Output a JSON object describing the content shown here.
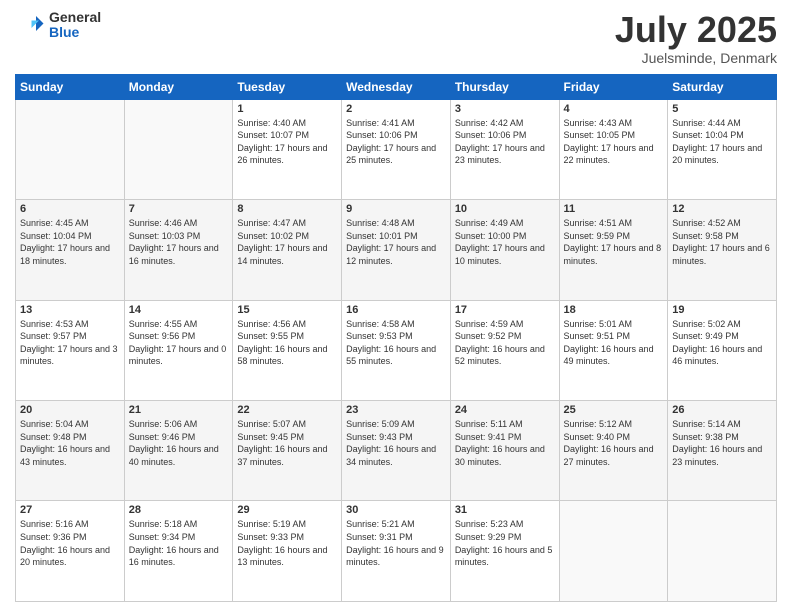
{
  "header": {
    "logo_general": "General",
    "logo_blue": "Blue",
    "title": "July 2025",
    "location": "Juelsminde, Denmark"
  },
  "days_of_week": [
    "Sunday",
    "Monday",
    "Tuesday",
    "Wednesday",
    "Thursday",
    "Friday",
    "Saturday"
  ],
  "weeks": [
    [
      {
        "day": "",
        "content": ""
      },
      {
        "day": "",
        "content": ""
      },
      {
        "day": "1",
        "content": "Sunrise: 4:40 AM\nSunset: 10:07 PM\nDaylight: 17 hours and 26 minutes."
      },
      {
        "day": "2",
        "content": "Sunrise: 4:41 AM\nSunset: 10:06 PM\nDaylight: 17 hours and 25 minutes."
      },
      {
        "day": "3",
        "content": "Sunrise: 4:42 AM\nSunset: 10:06 PM\nDaylight: 17 hours and 23 minutes."
      },
      {
        "day": "4",
        "content": "Sunrise: 4:43 AM\nSunset: 10:05 PM\nDaylight: 17 hours and 22 minutes."
      },
      {
        "day": "5",
        "content": "Sunrise: 4:44 AM\nSunset: 10:04 PM\nDaylight: 17 hours and 20 minutes."
      }
    ],
    [
      {
        "day": "6",
        "content": "Sunrise: 4:45 AM\nSunset: 10:04 PM\nDaylight: 17 hours and 18 minutes."
      },
      {
        "day": "7",
        "content": "Sunrise: 4:46 AM\nSunset: 10:03 PM\nDaylight: 17 hours and 16 minutes."
      },
      {
        "day": "8",
        "content": "Sunrise: 4:47 AM\nSunset: 10:02 PM\nDaylight: 17 hours and 14 minutes."
      },
      {
        "day": "9",
        "content": "Sunrise: 4:48 AM\nSunset: 10:01 PM\nDaylight: 17 hours and 12 minutes."
      },
      {
        "day": "10",
        "content": "Sunrise: 4:49 AM\nSunset: 10:00 PM\nDaylight: 17 hours and 10 minutes."
      },
      {
        "day": "11",
        "content": "Sunrise: 4:51 AM\nSunset: 9:59 PM\nDaylight: 17 hours and 8 minutes."
      },
      {
        "day": "12",
        "content": "Sunrise: 4:52 AM\nSunset: 9:58 PM\nDaylight: 17 hours and 6 minutes."
      }
    ],
    [
      {
        "day": "13",
        "content": "Sunrise: 4:53 AM\nSunset: 9:57 PM\nDaylight: 17 hours and 3 minutes."
      },
      {
        "day": "14",
        "content": "Sunrise: 4:55 AM\nSunset: 9:56 PM\nDaylight: 17 hours and 0 minutes."
      },
      {
        "day": "15",
        "content": "Sunrise: 4:56 AM\nSunset: 9:55 PM\nDaylight: 16 hours and 58 minutes."
      },
      {
        "day": "16",
        "content": "Sunrise: 4:58 AM\nSunset: 9:53 PM\nDaylight: 16 hours and 55 minutes."
      },
      {
        "day": "17",
        "content": "Sunrise: 4:59 AM\nSunset: 9:52 PM\nDaylight: 16 hours and 52 minutes."
      },
      {
        "day": "18",
        "content": "Sunrise: 5:01 AM\nSunset: 9:51 PM\nDaylight: 16 hours and 49 minutes."
      },
      {
        "day": "19",
        "content": "Sunrise: 5:02 AM\nSunset: 9:49 PM\nDaylight: 16 hours and 46 minutes."
      }
    ],
    [
      {
        "day": "20",
        "content": "Sunrise: 5:04 AM\nSunset: 9:48 PM\nDaylight: 16 hours and 43 minutes."
      },
      {
        "day": "21",
        "content": "Sunrise: 5:06 AM\nSunset: 9:46 PM\nDaylight: 16 hours and 40 minutes."
      },
      {
        "day": "22",
        "content": "Sunrise: 5:07 AM\nSunset: 9:45 PM\nDaylight: 16 hours and 37 minutes."
      },
      {
        "day": "23",
        "content": "Sunrise: 5:09 AM\nSunset: 9:43 PM\nDaylight: 16 hours and 34 minutes."
      },
      {
        "day": "24",
        "content": "Sunrise: 5:11 AM\nSunset: 9:41 PM\nDaylight: 16 hours and 30 minutes."
      },
      {
        "day": "25",
        "content": "Sunrise: 5:12 AM\nSunset: 9:40 PM\nDaylight: 16 hours and 27 minutes."
      },
      {
        "day": "26",
        "content": "Sunrise: 5:14 AM\nSunset: 9:38 PM\nDaylight: 16 hours and 23 minutes."
      }
    ],
    [
      {
        "day": "27",
        "content": "Sunrise: 5:16 AM\nSunset: 9:36 PM\nDaylight: 16 hours and 20 minutes."
      },
      {
        "day": "28",
        "content": "Sunrise: 5:18 AM\nSunset: 9:34 PM\nDaylight: 16 hours and 16 minutes."
      },
      {
        "day": "29",
        "content": "Sunrise: 5:19 AM\nSunset: 9:33 PM\nDaylight: 16 hours and 13 minutes."
      },
      {
        "day": "30",
        "content": "Sunrise: 5:21 AM\nSunset: 9:31 PM\nDaylight: 16 hours and 9 minutes."
      },
      {
        "day": "31",
        "content": "Sunrise: 5:23 AM\nSunset: 9:29 PM\nDaylight: 16 hours and 5 minutes."
      },
      {
        "day": "",
        "content": ""
      },
      {
        "day": "",
        "content": ""
      }
    ]
  ]
}
